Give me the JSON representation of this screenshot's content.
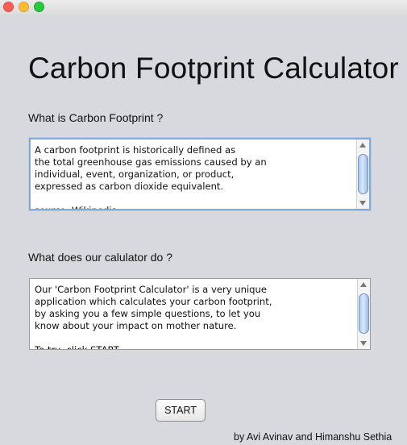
{
  "window": {
    "controls": {
      "close_color": "#fc5f57",
      "minimize_color": "#fdbc2e",
      "zoom_color": "#28c840"
    }
  },
  "app": {
    "title": "Carbon Footprint Calculator"
  },
  "section1": {
    "label": "What is Carbon Footprint ?",
    "text": "A carbon footprint is historically defined as\nthe total greenhouse gas emissions caused by an\nindividual, event, organization, or product,\nexpressed as carbon dioxide equivalent.\n\nsource: Wikipedia"
  },
  "section2": {
    "label": "What does our calulator do ?",
    "text": "Our 'Carbon Footprint Calculator' is a very unique\napplication which calculates your carbon footprint,\nby asking you a few simple questions, to let you\nknow about your impact on mother nature.\n\nTo try, click START"
  },
  "start_button": {
    "label": "START"
  },
  "footer": {
    "credits": "by Avi Avinav and Himanshu Sethia"
  }
}
